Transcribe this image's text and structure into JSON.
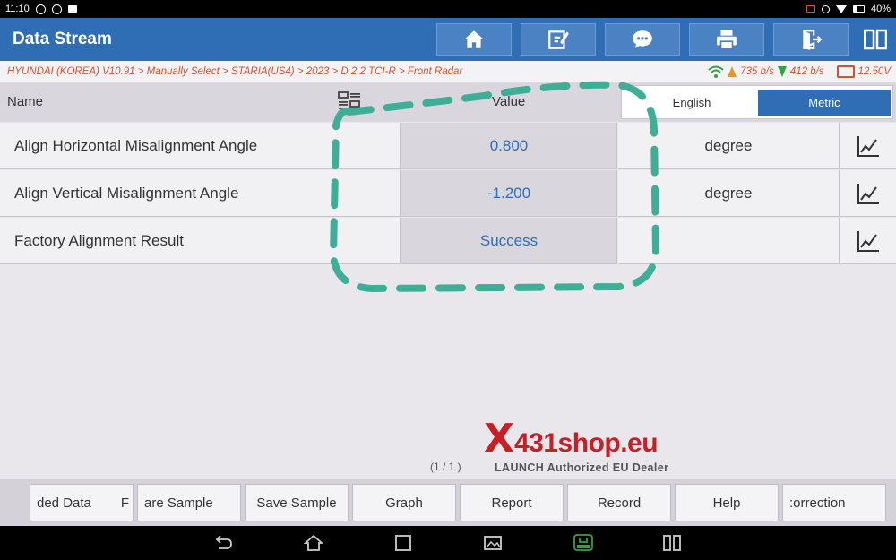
{
  "status_bar": {
    "time": "11:10",
    "battery": "40%"
  },
  "header": {
    "title": "Data Stream",
    "buttons": [
      {
        "icon": "home-icon"
      },
      {
        "icon": "edit-icon"
      },
      {
        "icon": "chat-icon"
      },
      {
        "icon": "print-icon"
      },
      {
        "icon": "exit-icon"
      }
    ]
  },
  "breadcrumb": {
    "path": "HYUNDAI (KOREA) V10.91 > Manually Select > STARIA(US4) > 2023 > D 2.2 TCI-R > Front Radar",
    "upload_rate": "735 b/s",
    "download_rate": "412 b/s",
    "voltage": "12.50V"
  },
  "table": {
    "col_name": "Name",
    "col_value": "Value",
    "unit_toggle": {
      "english": "English",
      "metric": "Metric",
      "selected": "Metric"
    },
    "rows": [
      {
        "name": "Align Horizontal Misalignment Angle",
        "value": "0.800",
        "unit": "degree"
      },
      {
        "name": "Align Vertical Misalignment Angle",
        "value": "-1.200",
        "unit": "degree"
      },
      {
        "name": "Factory Alignment Result",
        "value": "Success",
        "unit": ""
      }
    ]
  },
  "pager": "(1 / 1 )",
  "watermark": {
    "brand_x": "X",
    "brand": "431shop.eu",
    "tagline": "LAUNCH Authorized EU Dealer"
  },
  "toolbar": {
    "buttons": [
      "ded Data",
      "are Sample",
      "Save Sample",
      "Graph",
      "Report",
      "Record",
      "Help",
      ":orrection"
    ],
    "clipped_char": "F"
  },
  "colors": {
    "accent": "#2f6db5",
    "value_text": "#2f6db5",
    "crumb_text": "#d2542e",
    "annotation": "#3fae96",
    "watermark_red": "#c62026"
  }
}
